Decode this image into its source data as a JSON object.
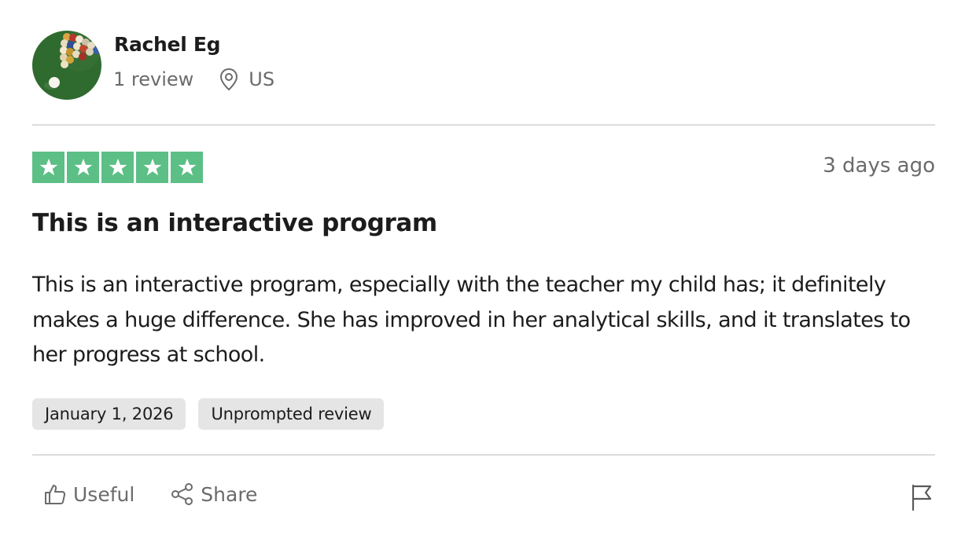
{
  "reviewer": {
    "name": "Rachel Eg",
    "review_count": "1 review",
    "country": "US",
    "avatar": "billiards-balls-avatar",
    "location_icon": "location-pin-icon"
  },
  "rating": {
    "stars": 5,
    "max_stars": 5,
    "star_color": "#5cbf86",
    "age": "3 days ago"
  },
  "review": {
    "title": "This is an interactive program",
    "body": "This is an interactive program, especially with the teacher my child has; it definitely makes a huge difference. She has improved in her analytical skills, and it translates to her progress at school.",
    "tags": [
      "January 1, 2026",
      "Unprompted review"
    ]
  },
  "actions": {
    "useful_label": "Useful",
    "useful_icon": "thumbs-up-icon",
    "share_label": "Share",
    "share_icon": "share-icon",
    "report_icon": "flag-icon"
  },
  "colors": {
    "text": "#1c1c1c",
    "muted": "#6b6b6b",
    "tag_bg": "#e5e5e5",
    "divider": "#dcdcdc"
  }
}
